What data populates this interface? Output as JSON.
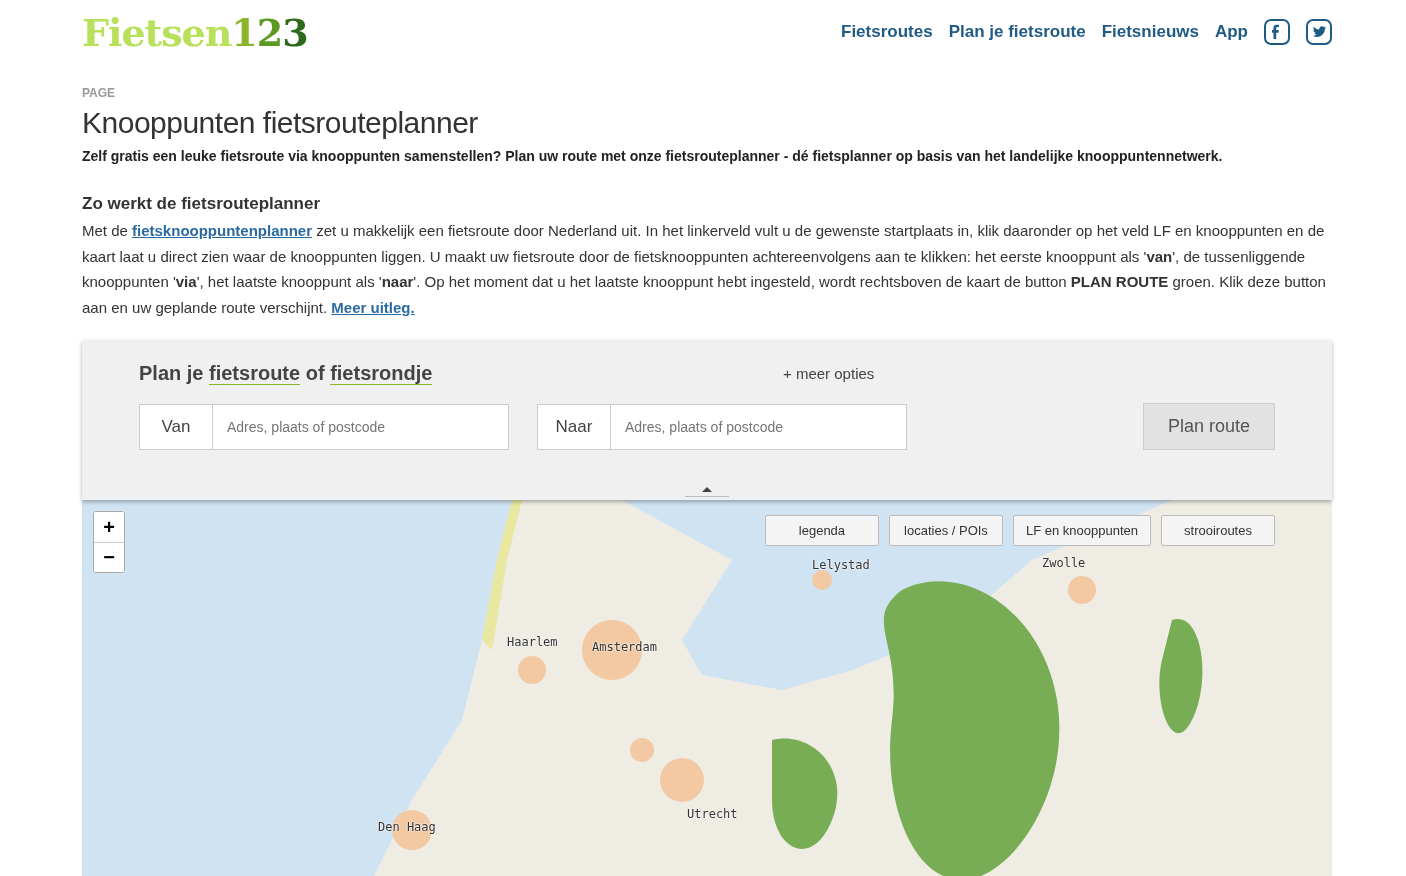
{
  "header": {
    "logo": {
      "word": "Fietsen",
      "digits": [
        "1",
        "2",
        "3"
      ]
    },
    "nav": [
      {
        "label": "Fietsroutes"
      },
      {
        "label": "Plan je fietsroute"
      },
      {
        "label": "Fietsnieuws"
      },
      {
        "label": "App"
      }
    ],
    "social": [
      {
        "kind": "facebook"
      },
      {
        "kind": "twitter"
      }
    ]
  },
  "page": {
    "eyebrow": "PAGE",
    "title": "Knooppunten fietsrouteplanner",
    "lead": "Zelf gratis een leuke fietsroute via knooppunten samenstellen? Plan uw route met onze fietsrouteplanner - dé fietsplanner op basis van het landelijke knooppuntennetwerk.",
    "section_title": "Zo werkt de fietsrouteplanner",
    "body": [
      {
        "kind": "text",
        "text": "Met de "
      },
      {
        "kind": "link",
        "text": "fietsknooppuntenplanner"
      },
      {
        "kind": "text",
        "text": " zet u makkelijk een fietsroute door Nederland uit. In het linkerveld vult u de gewenste startplaats in, klik daaronder op het veld LF en knooppunten en de kaart laat u direct zien waar de knooppunten liggen. U maakt uw fietsroute door de fietsknooppunten achtereenvolgens aan te klikken: het eerste knooppunt als '**van**', de tussenliggende knooppunten '**via**', het laatste knooppunt als '**naar**'. Op het moment dat u het laatste knooppunt hebt ingesteld, wordt rechtsboven de kaart de button **PLAN ROUTE** groen. Klik deze button aan en uw geplande route verschijnt. "
      },
      {
        "kind": "link",
        "text": "Meer uitleg."
      }
    ]
  },
  "planner": {
    "heading": [
      {
        "kind": "text",
        "text": "Plan je "
      },
      {
        "kind": "link",
        "text": "fietsroute"
      },
      {
        "kind": "text",
        "text": " of "
      },
      {
        "kind": "link",
        "text": "fietsrondje"
      }
    ],
    "more_options": {
      "icon": "+",
      "label": "meer opties"
    },
    "fields": [
      {
        "label": "Van",
        "placeholder": "Adres, plaats of postcode"
      },
      {
        "label": "Naar",
        "placeholder": "Adres, plaats of postcode"
      }
    ],
    "submit": {
      "label": "Plan route",
      "disabled": true
    }
  },
  "map": {
    "zoom": [
      "+",
      "−"
    ],
    "layers": [
      {
        "label": "legenda"
      },
      {
        "label": "locaties / POIs"
      },
      {
        "label": "LF en knooppunten"
      },
      {
        "label": "strooiroutes"
      }
    ],
    "places": [
      {
        "name": "Lelystad"
      },
      {
        "name": "Zwolle"
      },
      {
        "name": "Haarlem"
      },
      {
        "name": "Amsterdam"
      },
      {
        "name": "Utrecht"
      },
      {
        "name": "Den Haag"
      }
    ]
  }
}
